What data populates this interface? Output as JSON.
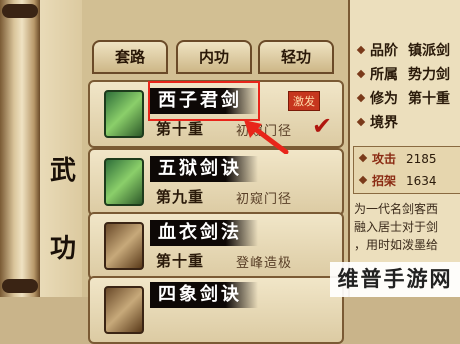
{
  "left_panel": {
    "chars": [
      "武",
      "功"
    ]
  },
  "tabs": [
    {
      "label": "套路",
      "active": true
    },
    {
      "label": "内功",
      "active": false
    },
    {
      "label": "轻功",
      "active": false
    }
  ],
  "skills": [
    {
      "name": "西子君剑",
      "stage": "第十重",
      "level": "初窥门径",
      "badge": "激发",
      "checked": true,
      "icon": "jade-scroll-icon"
    },
    {
      "name": "五狱剑诀",
      "stage": "第九重",
      "level": "初窥门径",
      "icon": "jade-scroll-icon"
    },
    {
      "name": "血衣剑法",
      "stage": "第十重",
      "level": "登峰造极",
      "icon": "book-icon"
    },
    {
      "name": "四象剑诀",
      "icon": "book-icon"
    }
  ],
  "details": {
    "attributes": [
      {
        "key": "品阶",
        "value": "镇派剑"
      },
      {
        "key": "所属",
        "value": "势力剑"
      },
      {
        "key": "修为",
        "value": "第十重"
      },
      {
        "key": "境界",
        "value": ""
      }
    ],
    "stats": [
      {
        "key": "攻击",
        "value": "2185"
      },
      {
        "key": "招架",
        "value": "1634"
      }
    ],
    "description": [
      "为一代名剑客西",
      "融入居士对于剑",
      "，用时如泼墨给"
    ]
  },
  "watermark": "维普手游网",
  "colors": {
    "highlight": "#e8251a",
    "badge": "#c6361e",
    "check": "#b0160e"
  }
}
